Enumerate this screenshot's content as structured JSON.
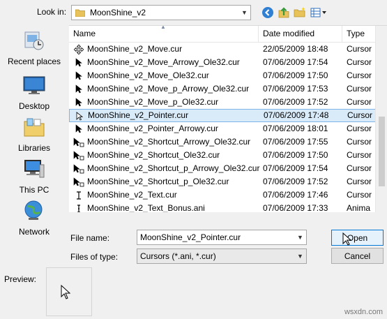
{
  "lookin": {
    "label": "Look in:",
    "value": "MoonShine_v2"
  },
  "toolbar": {
    "back_icon": "back-icon",
    "up_icon": "up-folder-icon",
    "new_folder_icon": "new-folder-icon",
    "view_icon": "view-menu-icon"
  },
  "places": [
    {
      "label": "Recent places",
      "icon": "recent-places-icon"
    },
    {
      "label": "Desktop",
      "icon": "desktop-icon"
    },
    {
      "label": "Libraries",
      "icon": "libraries-icon"
    },
    {
      "label": "This PC",
      "icon": "this-pc-icon"
    },
    {
      "label": "Network",
      "icon": "network-icon"
    }
  ],
  "columns": {
    "name": "Name",
    "date": "Date modified",
    "type": "Type"
  },
  "files": [
    {
      "name": "MoonShine_v2_Move.cur",
      "date": "22/05/2009 18:48",
      "type": "Cursor",
      "icon": "move-cursor-icon"
    },
    {
      "name": "MoonShine_v2_Move_Arrowy_Ole32.cur",
      "date": "07/06/2009 17:54",
      "type": "Cursor",
      "icon": "arrow-cursor-icon"
    },
    {
      "name": "MoonShine_v2_Move_Ole32.cur",
      "date": "07/06/2009 17:50",
      "type": "Cursor",
      "icon": "arrow-cursor-icon"
    },
    {
      "name": "MoonShine_v2_Move_p_Arrowy_Ole32.cur",
      "date": "07/06/2009 17:53",
      "type": "Cursor",
      "icon": "arrow-cursor-icon"
    },
    {
      "name": "MoonShine_v2_Move_p_Ole32.cur",
      "date": "07/06/2009 17:52",
      "type": "Cursor",
      "icon": "arrow-cursor-icon"
    },
    {
      "name": "MoonShine_v2_Pointer.cur",
      "date": "07/06/2009 17:48",
      "type": "Cursor",
      "icon": "pointer-cursor-icon",
      "selected": true
    },
    {
      "name": "MoonShine_v2_Pointer_Arrowy.cur",
      "date": "07/06/2009 18:01",
      "type": "Cursor",
      "icon": "arrow-cursor-icon"
    },
    {
      "name": "MoonShine_v2_Shortcut_Arrowy_Ole32.cur",
      "date": "07/06/2009 17:55",
      "type": "Cursor",
      "icon": "shortcut-cursor-icon"
    },
    {
      "name": "MoonShine_v2_Shortcut_Ole32.cur",
      "date": "07/06/2009 17:50",
      "type": "Cursor",
      "icon": "shortcut-cursor-icon"
    },
    {
      "name": "MoonShine_v2_Shortcut_p_Arrowy_Ole32.cur",
      "date": "07/06/2009 17:54",
      "type": "Cursor",
      "icon": "shortcut-cursor-icon"
    },
    {
      "name": "MoonShine_v2_Shortcut_p_Ole32.cur",
      "date": "07/06/2009 17:52",
      "type": "Cursor",
      "icon": "shortcut-cursor-icon"
    },
    {
      "name": "MoonShine_v2_Text.cur",
      "date": "07/06/2009 17:46",
      "type": "Cursor",
      "icon": "text-cursor-icon"
    },
    {
      "name": "MoonShine_v2_Text_Bonus.ani",
      "date": "07/06/2009 17:33",
      "type": "Anima",
      "icon": "text-bonus-cursor-icon"
    }
  ],
  "filename": {
    "label": "File name:",
    "value": "MoonShine_v2_Pointer.cur"
  },
  "filetype": {
    "label": "Files of type:",
    "value": "Cursors (*.ani, *.cur)"
  },
  "buttons": {
    "open": "Open",
    "cancel": "Cancel"
  },
  "preview": {
    "label": "Preview:"
  },
  "watermark": "wsxdn.com",
  "colors": {
    "selection_bg": "#d9ebf9",
    "selection_border": "#7eb4ea",
    "accent": "#0078d7"
  }
}
